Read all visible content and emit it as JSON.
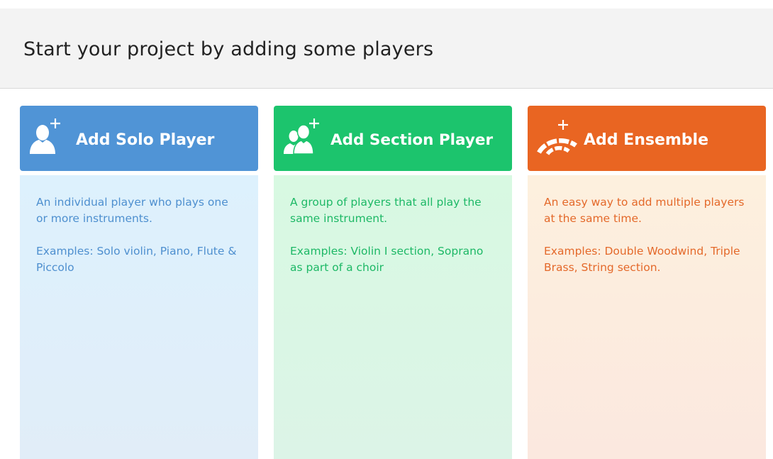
{
  "header": {
    "title": "Start your project by adding some players"
  },
  "cards": [
    {
      "button_label": "Add Solo Player",
      "icon": "solo-player-plus-icon",
      "color": "#5094d6",
      "description": "An individual player who plays one or more instruments.",
      "examples": "Examples: Solo violin, Piano, Flute & Piccolo"
    },
    {
      "button_label": "Add Section Player",
      "icon": "section-player-plus-icon",
      "color": "#1cc46d",
      "description": "A group of players that all play the same instrument.",
      "examples": "Examples: Violin I section, Soprano as part of a choir"
    },
    {
      "button_label": "Add Ensemble",
      "icon": "ensemble-plus-icon",
      "color": "#e96522",
      "description": "An easy way to add multiple players at the same time.",
      "examples": "Examples: Double Woodwind, Triple Brass, String section."
    }
  ]
}
